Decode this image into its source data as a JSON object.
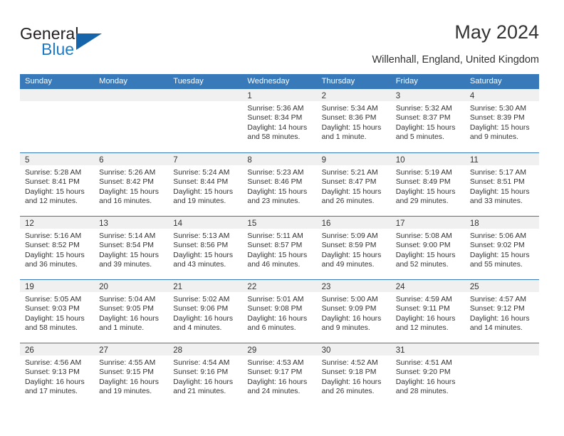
{
  "logo": {
    "word_top": "General",
    "word_bottom": "Blue",
    "triangle_color": "#1665AB",
    "blue_color": "#1F7AC4"
  },
  "header": {
    "title": "May 2024",
    "subtitle": "Willenhall, England, United Kingdom"
  },
  "theme": {
    "header_blue": "#3879B9",
    "day_strip_gray": "#F0F0F0",
    "text": "#333333"
  },
  "calendar": {
    "weekdays": [
      "Sunday",
      "Monday",
      "Tuesday",
      "Wednesday",
      "Thursday",
      "Friday",
      "Saturday"
    ],
    "labels": {
      "sunrise": "Sunrise:",
      "sunset": "Sunset:",
      "daylight": "Daylight:"
    },
    "weeks": [
      [
        {
          "day": "",
          "sunrise": "",
          "sunset": "",
          "daylight_line1": "",
          "daylight_line2": ""
        },
        {
          "day": "",
          "sunrise": "",
          "sunset": "",
          "daylight_line1": "",
          "daylight_line2": ""
        },
        {
          "day": "",
          "sunrise": "",
          "sunset": "",
          "daylight_line1": "",
          "daylight_line2": ""
        },
        {
          "day": "1",
          "sunrise": "Sunrise: 5:36 AM",
          "sunset": "Sunset: 8:34 PM",
          "daylight_line1": "Daylight: 14 hours",
          "daylight_line2": "and 58 minutes."
        },
        {
          "day": "2",
          "sunrise": "Sunrise: 5:34 AM",
          "sunset": "Sunset: 8:36 PM",
          "daylight_line1": "Daylight: 15 hours",
          "daylight_line2": "and 1 minute."
        },
        {
          "day": "3",
          "sunrise": "Sunrise: 5:32 AM",
          "sunset": "Sunset: 8:37 PM",
          "daylight_line1": "Daylight: 15 hours",
          "daylight_line2": "and 5 minutes."
        },
        {
          "day": "4",
          "sunrise": "Sunrise: 5:30 AM",
          "sunset": "Sunset: 8:39 PM",
          "daylight_line1": "Daylight: 15 hours",
          "daylight_line2": "and 9 minutes."
        }
      ],
      [
        {
          "day": "5",
          "sunrise": "Sunrise: 5:28 AM",
          "sunset": "Sunset: 8:41 PM",
          "daylight_line1": "Daylight: 15 hours",
          "daylight_line2": "and 12 minutes."
        },
        {
          "day": "6",
          "sunrise": "Sunrise: 5:26 AM",
          "sunset": "Sunset: 8:42 PM",
          "daylight_line1": "Daylight: 15 hours",
          "daylight_line2": "and 16 minutes."
        },
        {
          "day": "7",
          "sunrise": "Sunrise: 5:24 AM",
          "sunset": "Sunset: 8:44 PM",
          "daylight_line1": "Daylight: 15 hours",
          "daylight_line2": "and 19 minutes."
        },
        {
          "day": "8",
          "sunrise": "Sunrise: 5:23 AM",
          "sunset": "Sunset: 8:46 PM",
          "daylight_line1": "Daylight: 15 hours",
          "daylight_line2": "and 23 minutes."
        },
        {
          "day": "9",
          "sunrise": "Sunrise: 5:21 AM",
          "sunset": "Sunset: 8:47 PM",
          "daylight_line1": "Daylight: 15 hours",
          "daylight_line2": "and 26 minutes."
        },
        {
          "day": "10",
          "sunrise": "Sunrise: 5:19 AM",
          "sunset": "Sunset: 8:49 PM",
          "daylight_line1": "Daylight: 15 hours",
          "daylight_line2": "and 29 minutes."
        },
        {
          "day": "11",
          "sunrise": "Sunrise: 5:17 AM",
          "sunset": "Sunset: 8:51 PM",
          "daylight_line1": "Daylight: 15 hours",
          "daylight_line2": "and 33 minutes."
        }
      ],
      [
        {
          "day": "12",
          "sunrise": "Sunrise: 5:16 AM",
          "sunset": "Sunset: 8:52 PM",
          "daylight_line1": "Daylight: 15 hours",
          "daylight_line2": "and 36 minutes."
        },
        {
          "day": "13",
          "sunrise": "Sunrise: 5:14 AM",
          "sunset": "Sunset: 8:54 PM",
          "daylight_line1": "Daylight: 15 hours",
          "daylight_line2": "and 39 minutes."
        },
        {
          "day": "14",
          "sunrise": "Sunrise: 5:13 AM",
          "sunset": "Sunset: 8:56 PM",
          "daylight_line1": "Daylight: 15 hours",
          "daylight_line2": "and 43 minutes."
        },
        {
          "day": "15",
          "sunrise": "Sunrise: 5:11 AM",
          "sunset": "Sunset: 8:57 PM",
          "daylight_line1": "Daylight: 15 hours",
          "daylight_line2": "and 46 minutes."
        },
        {
          "day": "16",
          "sunrise": "Sunrise: 5:09 AM",
          "sunset": "Sunset: 8:59 PM",
          "daylight_line1": "Daylight: 15 hours",
          "daylight_line2": "and 49 minutes."
        },
        {
          "day": "17",
          "sunrise": "Sunrise: 5:08 AM",
          "sunset": "Sunset: 9:00 PM",
          "daylight_line1": "Daylight: 15 hours",
          "daylight_line2": "and 52 minutes."
        },
        {
          "day": "18",
          "sunrise": "Sunrise: 5:06 AM",
          "sunset": "Sunset: 9:02 PM",
          "daylight_line1": "Daylight: 15 hours",
          "daylight_line2": "and 55 minutes."
        }
      ],
      [
        {
          "day": "19",
          "sunrise": "Sunrise: 5:05 AM",
          "sunset": "Sunset: 9:03 PM",
          "daylight_line1": "Daylight: 15 hours",
          "daylight_line2": "and 58 minutes."
        },
        {
          "day": "20",
          "sunrise": "Sunrise: 5:04 AM",
          "sunset": "Sunset: 9:05 PM",
          "daylight_line1": "Daylight: 16 hours",
          "daylight_line2": "and 1 minute."
        },
        {
          "day": "21",
          "sunrise": "Sunrise: 5:02 AM",
          "sunset": "Sunset: 9:06 PM",
          "daylight_line1": "Daylight: 16 hours",
          "daylight_line2": "and 4 minutes."
        },
        {
          "day": "22",
          "sunrise": "Sunrise: 5:01 AM",
          "sunset": "Sunset: 9:08 PM",
          "daylight_line1": "Daylight: 16 hours",
          "daylight_line2": "and 6 minutes."
        },
        {
          "day": "23",
          "sunrise": "Sunrise: 5:00 AM",
          "sunset": "Sunset: 9:09 PM",
          "daylight_line1": "Daylight: 16 hours",
          "daylight_line2": "and 9 minutes."
        },
        {
          "day": "24",
          "sunrise": "Sunrise: 4:59 AM",
          "sunset": "Sunset: 9:11 PM",
          "daylight_line1": "Daylight: 16 hours",
          "daylight_line2": "and 12 minutes."
        },
        {
          "day": "25",
          "sunrise": "Sunrise: 4:57 AM",
          "sunset": "Sunset: 9:12 PM",
          "daylight_line1": "Daylight: 16 hours",
          "daylight_line2": "and 14 minutes."
        }
      ],
      [
        {
          "day": "26",
          "sunrise": "Sunrise: 4:56 AM",
          "sunset": "Sunset: 9:13 PM",
          "daylight_line1": "Daylight: 16 hours",
          "daylight_line2": "and 17 minutes."
        },
        {
          "day": "27",
          "sunrise": "Sunrise: 4:55 AM",
          "sunset": "Sunset: 9:15 PM",
          "daylight_line1": "Daylight: 16 hours",
          "daylight_line2": "and 19 minutes."
        },
        {
          "day": "28",
          "sunrise": "Sunrise: 4:54 AM",
          "sunset": "Sunset: 9:16 PM",
          "daylight_line1": "Daylight: 16 hours",
          "daylight_line2": "and 21 minutes."
        },
        {
          "day": "29",
          "sunrise": "Sunrise: 4:53 AM",
          "sunset": "Sunset: 9:17 PM",
          "daylight_line1": "Daylight: 16 hours",
          "daylight_line2": "and 24 minutes."
        },
        {
          "day": "30",
          "sunrise": "Sunrise: 4:52 AM",
          "sunset": "Sunset: 9:18 PM",
          "daylight_line1": "Daylight: 16 hours",
          "daylight_line2": "and 26 minutes."
        },
        {
          "day": "31",
          "sunrise": "Sunrise: 4:51 AM",
          "sunset": "Sunset: 9:20 PM",
          "daylight_line1": "Daylight: 16 hours",
          "daylight_line2": "and 28 minutes."
        },
        {
          "day": "",
          "sunrise": "",
          "sunset": "",
          "daylight_line1": "",
          "daylight_line2": ""
        }
      ]
    ]
  }
}
